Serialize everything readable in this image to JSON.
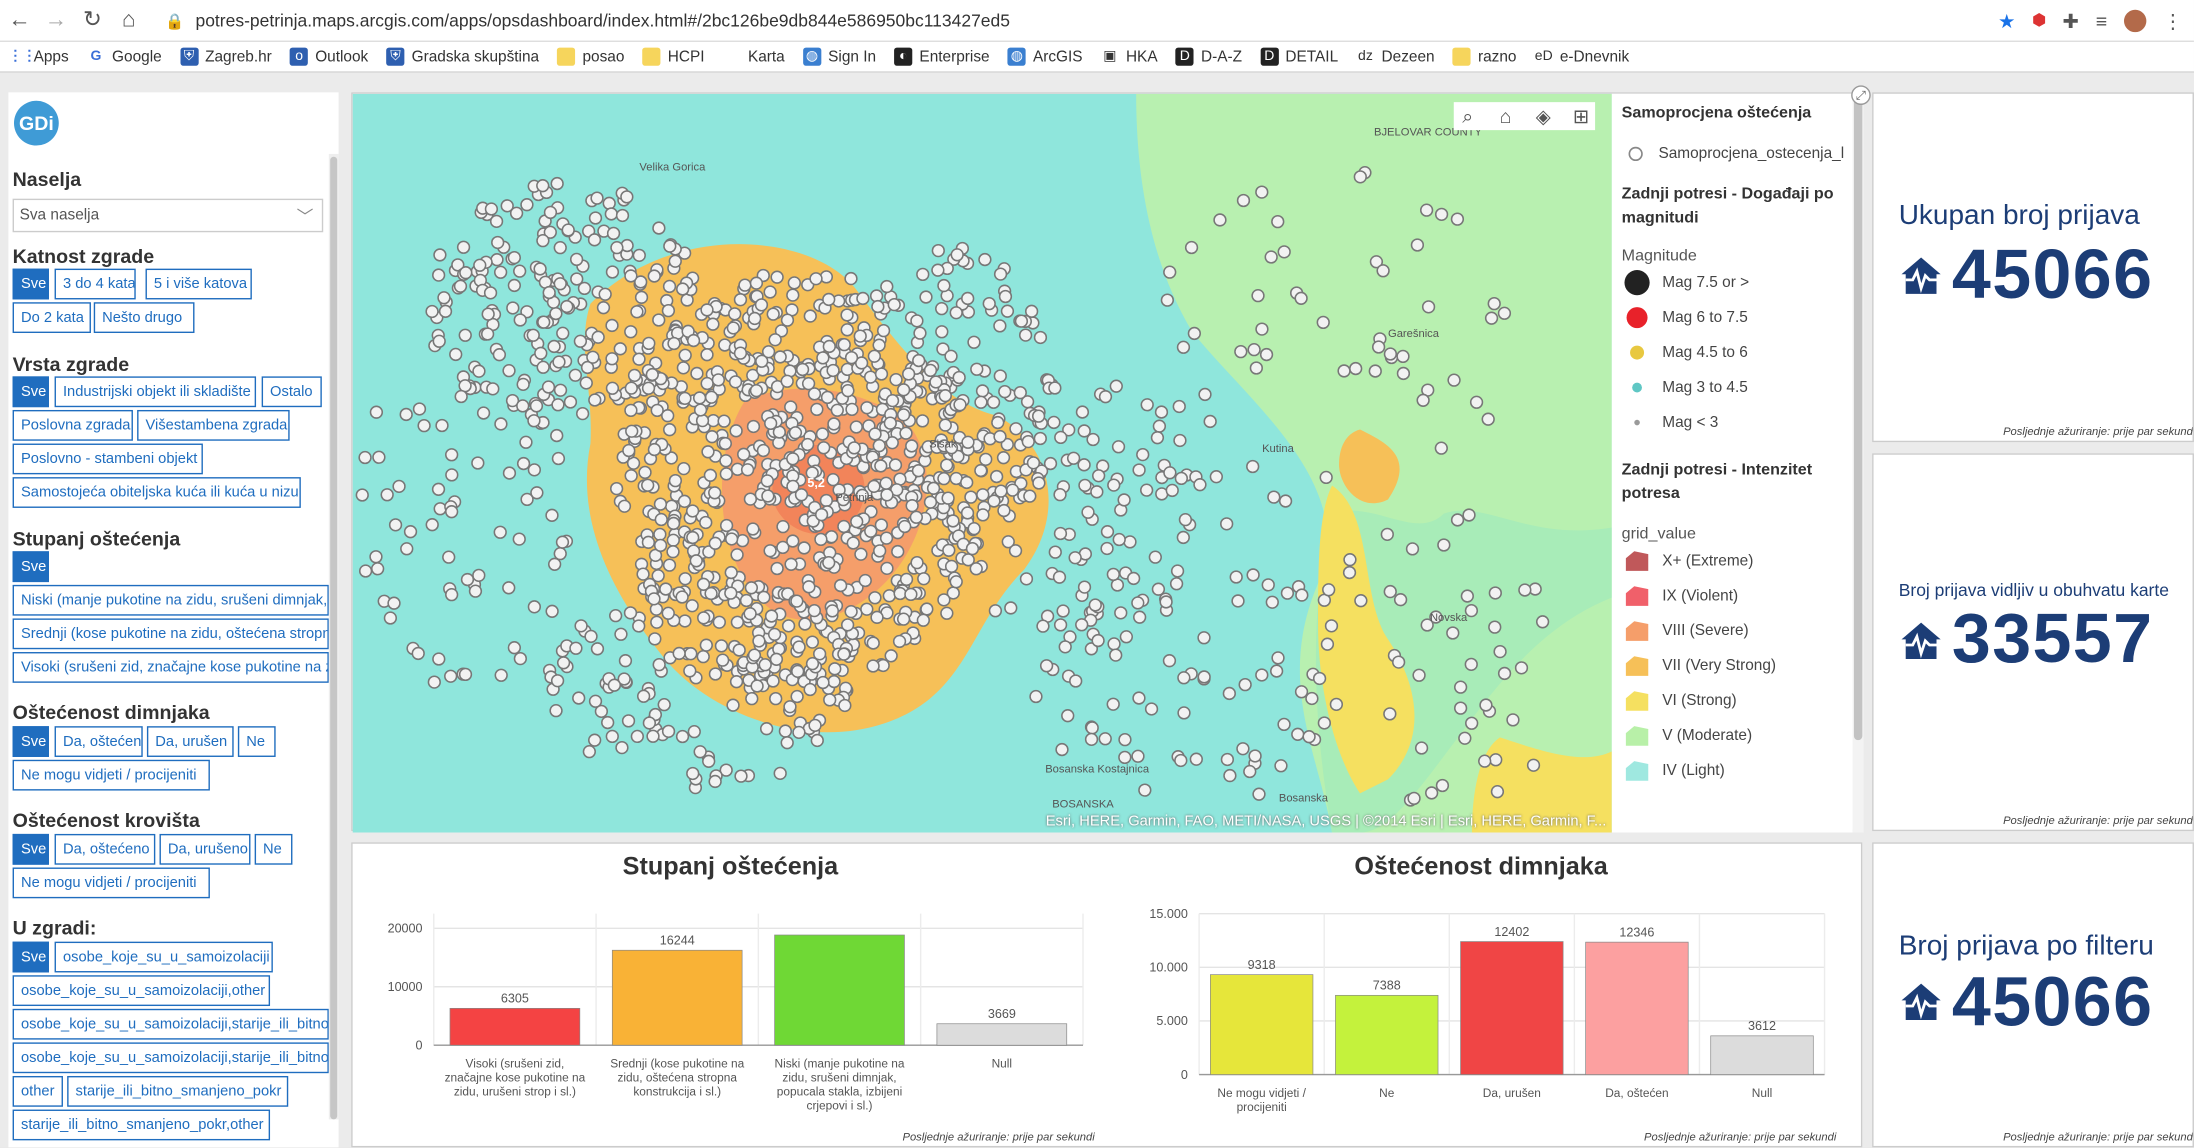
{
  "browser": {
    "url": "potres-petrinja.maps.arcgis.com/apps/opsdashboard/index.html#/2bc126be9db844e586950bc113427ed5",
    "bookmarks": [
      {
        "label": "Apps",
        "icon": "apps-grid-icon"
      },
      {
        "label": "Google",
        "icon": "google-icon"
      },
      {
        "label": "Zagreb.hr",
        "icon": "zagreb-icon"
      },
      {
        "label": "Outlook",
        "icon": "outlook-icon"
      },
      {
        "label": "Gradska skupština",
        "icon": "zagreb-icon"
      },
      {
        "label": "posao",
        "icon": "folder-icon"
      },
      {
        "label": "HCPI",
        "icon": "folder-icon"
      },
      {
        "label": "Karta",
        "icon": "blank-icon"
      },
      {
        "label": "Sign In",
        "icon": "arcgis-icon"
      },
      {
        "label": "Enterprise",
        "icon": "enterprise-icon"
      },
      {
        "label": "ArcGIS",
        "icon": "arcgis-icon"
      },
      {
        "label": "HKA",
        "icon": "hka-icon"
      },
      {
        "label": "D-A-Z",
        "icon": "daz-icon"
      },
      {
        "label": "DETAIL",
        "icon": "detail-icon"
      },
      {
        "label": "Dezeen",
        "icon": "dezeen-icon"
      },
      {
        "label": "razno",
        "icon": "folder-icon"
      },
      {
        "label": "e-Dnevnik",
        "icon": "ednevnik-icon"
      }
    ]
  },
  "sidebar": {
    "logo": "GDi",
    "naselja": {
      "title": "Naselja",
      "selected": "Sva naselja"
    },
    "katnost": {
      "title": "Katnost zgrade",
      "options": [
        "Sve",
        "3 do 4 kata",
        "5 i više katova",
        "Do 2 kata",
        "Nešto drugo"
      ]
    },
    "vrsta": {
      "title": "Vrsta zgrade",
      "options": [
        "Sve",
        "Industrijski objekt ili skladište",
        "Ostalo",
        "Poslovna zgrada",
        "Višestambena zgrada",
        "Poslovno - stambeni objekt",
        "Samostojeća obiteljska kuća ili kuća u nizu"
      ]
    },
    "stupanj": {
      "title": "Stupanj oštećenja",
      "options": [
        "Sve",
        "Niski (manje pukotine na zidu, srušeni dimnjak, popucala stakla, izbijeni crjepovi i sl.)",
        "Srednji (kose pukotine na zidu, oštećena stropna konstrukcija i sl.)",
        "Visoki (srušeni zid, značajne kose pukotine na zidu, urušeni strop i sl.)"
      ]
    },
    "dimnjak": {
      "title": "Oštećenost dimnjaka",
      "options": [
        "Sve",
        "Da, oštećen",
        "Da, urušen",
        "Ne",
        "Ne mogu vidjeti / procijeniti"
      ]
    },
    "krov": {
      "title": "Oštećenost krovišta",
      "options": [
        "Sve",
        "Da, oštećeno",
        "Da, urušeno",
        "Ne",
        "Ne mogu vidjeti / procijeniti"
      ]
    },
    "uzgradi": {
      "title": "U zgradi:",
      "options": [
        "Sve",
        "osobe_koje_su_u_samoizolaciji",
        "osobe_koje_su_u_samoizolaciji,other",
        "osobe_koje_su_u_samoizolaciji,starije_ili_bitno_smanjene_pokretljivosti",
        "osobe_koje_su_u_samoizolaciji,starije_ili_bitno_smanjene_pokretljivosti,other",
        "other",
        "starije_ili_bitno_smanjeno_pokr",
        "starije_ili_bitno_smanjeno_pokr,other"
      ]
    }
  },
  "map": {
    "labels": [
      "BJELOVAR COUNTY",
      "Velika Gorica",
      "Sisak",
      "Petrinja",
      "Garešnica",
      "Kutina",
      "Novska",
      "Bosanska Kostajnica",
      "BOSANSKA",
      "Bosanska"
    ],
    "cluster_label": "5,2",
    "attribution": "Esri, HERE, Garmin, FAO, METI/NASA, USGS | ©2014 Esri | Esri, HERE, Garmin, F...",
    "tools": [
      "search-icon",
      "home-icon",
      "layers-icon",
      "basemap-gallery-icon"
    ]
  },
  "legend": {
    "layer1_title": "Samoprocjena oštećenja",
    "layer1_item": "Samoprocjena_ostecenja_l",
    "layer2_title": "Zadnji potresi - Događaji po magnitudi",
    "magnitude_label": "Magnitude",
    "magnitudes": [
      {
        "label": "Mag 7.5 or >",
        "color": "#222222"
      },
      {
        "label": "Mag 6 to 7.5",
        "color": "#e8222a"
      },
      {
        "label": "Mag 4.5 to 6",
        "color": "#e8c840"
      },
      {
        "label": "Mag 3 to 4.5",
        "color": "#5fc7c4"
      },
      {
        "label": "Mag < 3",
        "color": "#9a9a9a"
      }
    ],
    "layer3_title": "Zadnji potresi - Intenzitet potresa",
    "grid_label": "grid_value",
    "intensities": [
      {
        "label": "X+ (Extreme)",
        "color": "#c0585a"
      },
      {
        "label": "IX (Violent)",
        "color": "#f0606a"
      },
      {
        "label": "VIII (Severe)",
        "color": "#f59e6a"
      },
      {
        "label": "VII (Very Strong)",
        "color": "#f6c058"
      },
      {
        "label": "VI (Strong)",
        "color": "#f5e060"
      },
      {
        "label": "V (Moderate)",
        "color": "#b8f0a8"
      },
      {
        "label": "IV (Light)",
        "color": "#9fe8e0"
      }
    ]
  },
  "kpis": [
    {
      "title": "Ukupan broj prijava",
      "value": "45066",
      "updated": "Posljednje ažuriranje: prije par sekundi"
    },
    {
      "title": "Broj prijava vidljiv u obuhvatu karte",
      "value": "33557",
      "updated": "Posljednje ažuriranje: prije par sekundi"
    },
    {
      "title": "Broj prijava po filteru",
      "value": "45066",
      "updated": "Posljednje ažuriranje: prije par sekundi"
    }
  ],
  "chart_data": [
    {
      "type": "bar",
      "title": "Stupanj oštećenja",
      "categories": [
        "Visoki (srušeni zid, značajne kose pukotine na zidu, urušeni strop i sl.)",
        "Srednji (kose pukotine na zidu, oštećena stropna konstrukcija i sl.)",
        "Niski (manje pukotine na zidu, srušeni dimnjak, popucala stakla, izbijeni crjepovi i sl.)",
        "Null"
      ],
      "category_lines": [
        [
          "Visoki (srušeni zid,",
          "značajne kose pukotine na",
          "zidu, urušeni strop i sl.)"
        ],
        [
          "Srednji (kose pukotine na",
          "zidu, oštećena stropna",
          "konstrukcija i sl.)"
        ],
        [
          "Niski (manje pukotine na",
          "zidu, srušeni dimnjak,",
          "popucala stakla, izbijeni",
          "crjepovi i sl.)"
        ],
        [
          "Null"
        ]
      ],
      "values": [
        6305,
        16244,
        18850,
        3669
      ],
      "data_labels": [
        "6305",
        "16244",
        "",
        "3669"
      ],
      "colors": [
        "#f44343",
        "#f9b236",
        "#6fd835",
        "#dcdcdc"
      ],
      "yticks": [
        "20000",
        "10000",
        "0"
      ],
      "ytick_values": [
        20000,
        10000,
        0
      ],
      "ylim": [
        0,
        22500
      ],
      "footer": "Posljednje ažuriranje: prije par sekundi"
    },
    {
      "type": "bar",
      "title": "Oštećenost dimnjaka",
      "categories": [
        "Ne mogu vidjeti / procijeniti",
        "Ne",
        "Da, urušen",
        "Da, oštećen",
        "Null"
      ],
      "category_lines": [
        [
          "Ne mogu vidjeti /",
          "procijeniti"
        ],
        [
          "Ne"
        ],
        [
          "Da, urušen"
        ],
        [
          "Da, oštećen"
        ],
        [
          "Null"
        ]
      ],
      "values": [
        9318,
        7388,
        12402,
        12346,
        3612
      ],
      "data_labels": [
        "9318",
        "7388",
        "12402",
        "12346",
        "3612"
      ],
      "colors": [
        "#e6e63a",
        "#c4f23c",
        "#f04545",
        "#fca0a0",
        "#dcdcdc"
      ],
      "yticks": [
        "15.000",
        "10.000",
        "5.000",
        "0"
      ],
      "ytick_values": [
        15000,
        10000,
        5000,
        0
      ],
      "ylim": [
        0,
        15000
      ],
      "footer": "Posljednje ažuriranje: prije par sekundi"
    }
  ]
}
